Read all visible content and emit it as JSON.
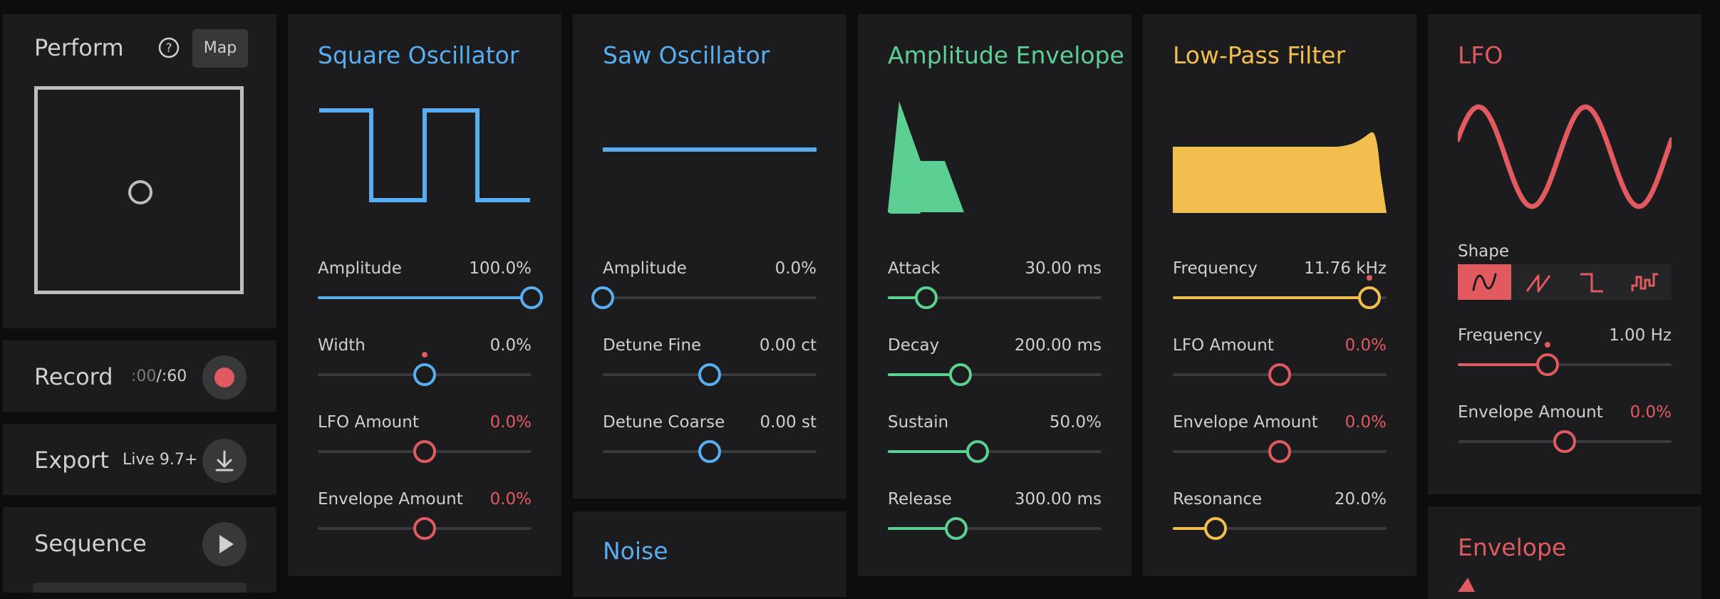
{
  "colors": {
    "blue": "#58aef0",
    "green": "#5ccf92",
    "yellow": "#f2bf4e",
    "red": "#e05a5f",
    "panel": "#1c1c1e",
    "track": "#3a3a3c"
  },
  "sidebar": {
    "perform": {
      "title": "Perform",
      "help_icon": "question-circle-icon",
      "map_label": "Map"
    },
    "record": {
      "title": "Record",
      "time_elapsed": ":00",
      "time_separator": "/",
      "time_total": ":60",
      "icon": "record-icon"
    },
    "export": {
      "title": "Export",
      "version": "Live 9.7+",
      "icon": "download-icon"
    },
    "sequence": {
      "title": "Sequence",
      "icon": "play-icon"
    }
  },
  "square": {
    "title": "Square Oscillator",
    "params": [
      {
        "label": "Amplitude",
        "value": "100.0%",
        "level": 1.0,
        "color": "blue",
        "filled": true
      },
      {
        "label": "Width",
        "value": "0.0%",
        "level": 0.5,
        "color": "blue",
        "filled": false,
        "mod": true
      },
      {
        "label": "LFO Amount",
        "value": "0.0%",
        "level": 0.5,
        "color": "red",
        "filled": false,
        "red_value": true
      },
      {
        "label": "Envelope Amount",
        "value": "0.0%",
        "level": 0.5,
        "color": "red",
        "filled": false,
        "red_value": true
      }
    ]
  },
  "saw": {
    "title": "Saw Oscillator",
    "params": [
      {
        "label": "Amplitude",
        "value": "0.0%",
        "level": 0.0,
        "color": "blue",
        "filled": true
      },
      {
        "label": "Detune Fine",
        "value": "0.00 ct",
        "level": 0.5,
        "color": "blue",
        "filled": false
      },
      {
        "label": "Detune Coarse",
        "value": "0.00 st",
        "level": 0.5,
        "color": "blue",
        "filled": false
      }
    ]
  },
  "noise": {
    "title": "Noise"
  },
  "amp_env": {
    "title": "Amplitude Envelope",
    "params": [
      {
        "label": "Attack",
        "value": "30.00 ms",
        "level": 0.18,
        "color": "green",
        "filled": true
      },
      {
        "label": "Decay",
        "value": "200.00 ms",
        "level": 0.34,
        "color": "green",
        "filled": true
      },
      {
        "label": "Sustain",
        "value": "50.0%",
        "level": 0.42,
        "color": "green",
        "filled": true
      },
      {
        "label": "Release",
        "value": "300.00 ms",
        "level": 0.32,
        "color": "green",
        "filled": true
      }
    ]
  },
  "filter": {
    "title": "Low-Pass Filter",
    "params": [
      {
        "label": "Frequency",
        "value": "11.76 kHz",
        "level": 0.92,
        "color": "yellow",
        "filled": true,
        "mod": true
      },
      {
        "label": "LFO Amount",
        "value": "0.0%",
        "level": 0.5,
        "color": "red",
        "filled": false,
        "red_value": true
      },
      {
        "label": "Envelope Amount",
        "value": "0.0%",
        "level": 0.5,
        "color": "red",
        "filled": false,
        "red_value": true
      },
      {
        "label": "Resonance",
        "value": "20.0%",
        "level": 0.2,
        "color": "yellow",
        "filled": true
      }
    ]
  },
  "lfo": {
    "title": "LFO",
    "shape_label": "Shape",
    "shapes": [
      "sine-wave-icon",
      "sawtooth-wave-icon",
      "square-wave-icon",
      "random-steps-icon"
    ],
    "selected_shape": 0,
    "params": [
      {
        "label": "Frequency",
        "value": "1.00 Hz",
        "level": 0.42,
        "color": "red",
        "filled": true,
        "mod": true
      },
      {
        "label": "Envelope Amount",
        "value": "0.0%",
        "level": 0.5,
        "color": "red",
        "filled": false,
        "red_value": true
      }
    ]
  },
  "envelope": {
    "title": "Envelope"
  }
}
